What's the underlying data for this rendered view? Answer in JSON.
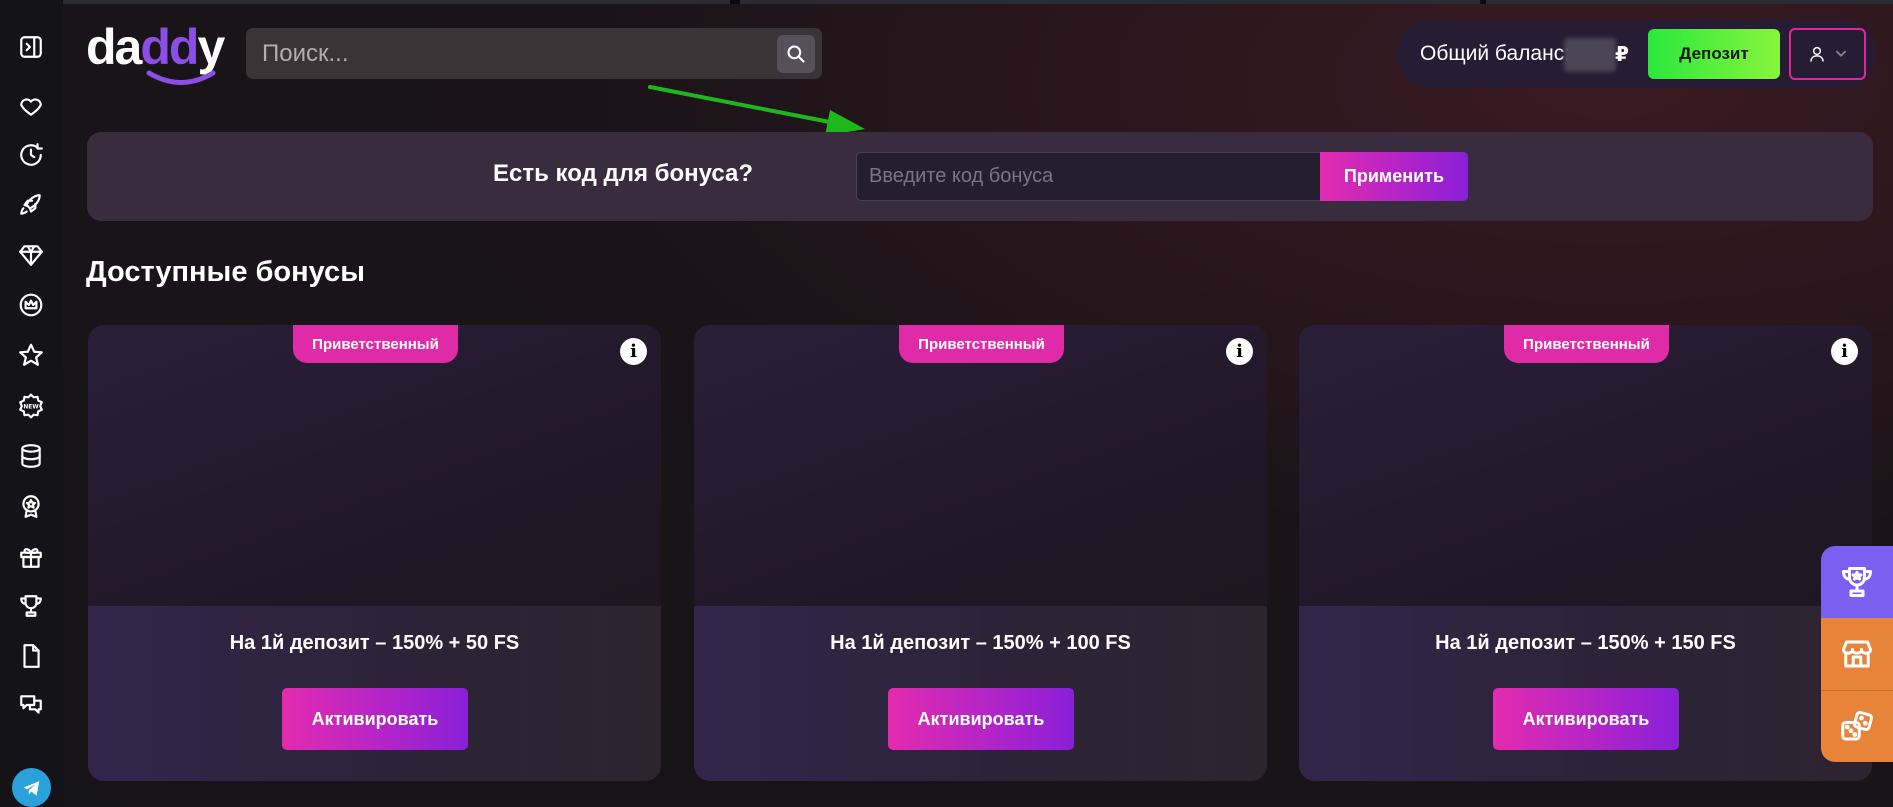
{
  "header": {
    "logo": "daddy",
    "search_placeholder": "Поиск...",
    "balance_label": "Общий баланс:",
    "balance_currency": "₽",
    "deposit_label": "Депозит"
  },
  "sidebar": {
    "icons": [
      "panel-toggle-icon",
      "heart-icon",
      "recent-icon",
      "rocket-icon",
      "diamond-icon",
      "crown-icon",
      "star-icon",
      "new-badge-icon",
      "database-icon",
      "medal-icon",
      "gift-icon",
      "trophy-icon",
      "document-icon",
      "chat-icon",
      "telegram-icon"
    ],
    "new_badge_text": "NEW"
  },
  "bonus_code": {
    "title": "Есть код для бонуса?",
    "input_placeholder": "Введите код бонуса",
    "apply_label": "Применить"
  },
  "section_title": "Доступные бонусы",
  "cards": [
    {
      "badge": "Приветственный",
      "info": "i",
      "title": "На 1й депозит – 150% + 50 FS",
      "button": "Активировать"
    },
    {
      "badge": "Приветственный",
      "info": "i",
      "title": "На 1й депозит – 150% + 100 FS",
      "button": "Активировать"
    },
    {
      "badge": "Приветственный",
      "info": "i",
      "title": "На 1й депозит – 150% + 150 FS",
      "button": "Активировать"
    }
  ],
  "floating": [
    "trophy-icon",
    "shop-icon",
    "dice-icon"
  ],
  "colors": {
    "accent_pink": "#e02ba8",
    "accent_purple": "#8a1fd9",
    "deposit_green": "#2ae83d",
    "annotation_arrow": "#1fb81c"
  }
}
